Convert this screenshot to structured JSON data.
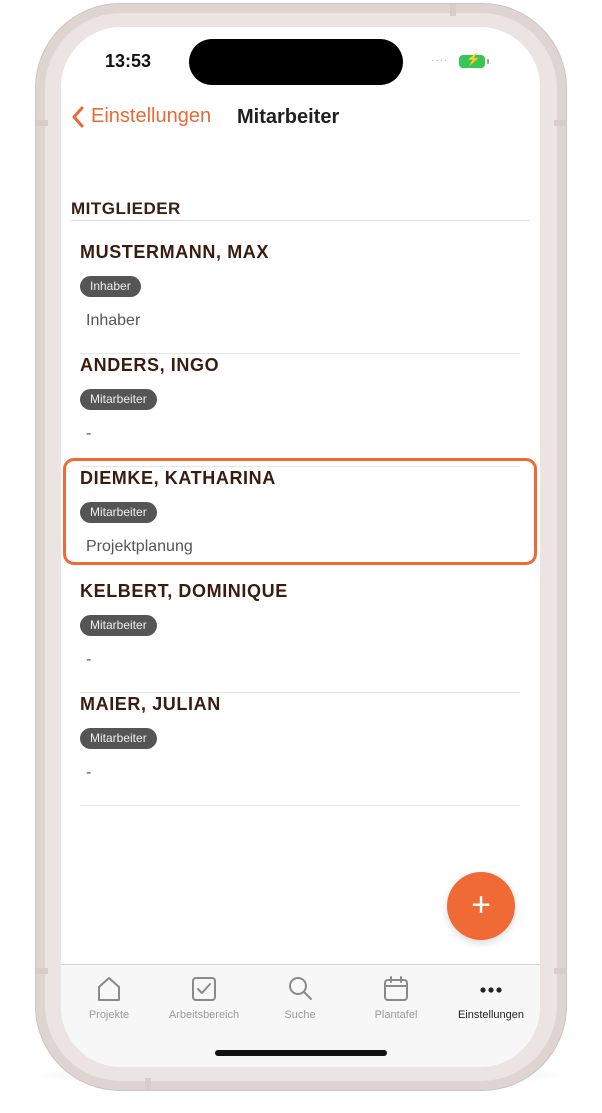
{
  "status": {
    "time": "13:53"
  },
  "nav": {
    "back_label": "Einstellungen",
    "title": "Mitarbeiter"
  },
  "section": {
    "title": "Mitglieder"
  },
  "members": [
    {
      "name": "Mustermann, Max",
      "role": "Inhaber",
      "description": "Inhaber"
    },
    {
      "name": "Anders, Ingo",
      "role": "Mitarbeiter",
      "description": "-"
    },
    {
      "name": "Diemke, Katharina",
      "role": "Mitarbeiter",
      "description": "Projektplanung",
      "highlighted": true
    },
    {
      "name": "Kelbert, Dominique",
      "role": "Mitarbeiter",
      "description": "-"
    },
    {
      "name": "Maier, Julian",
      "role": "Mitarbeiter",
      "description": "-"
    }
  ],
  "fab": {
    "icon": "plus-icon",
    "label": "+"
  },
  "tabbar": {
    "tabs": [
      {
        "label": "Projekte",
        "icon": "house-icon"
      },
      {
        "label": "Arbeitsbereich",
        "icon": "checkbox-icon"
      },
      {
        "label": "Suche",
        "icon": "search-icon"
      },
      {
        "label": "Plantafel",
        "icon": "calendar-icon"
      },
      {
        "label": "Einstellungen",
        "icon": "more-dots-icon",
        "active": true
      }
    ]
  },
  "colors": {
    "accent": "#ef6a34",
    "badge": "#555555",
    "name": "#3a1c0f"
  }
}
